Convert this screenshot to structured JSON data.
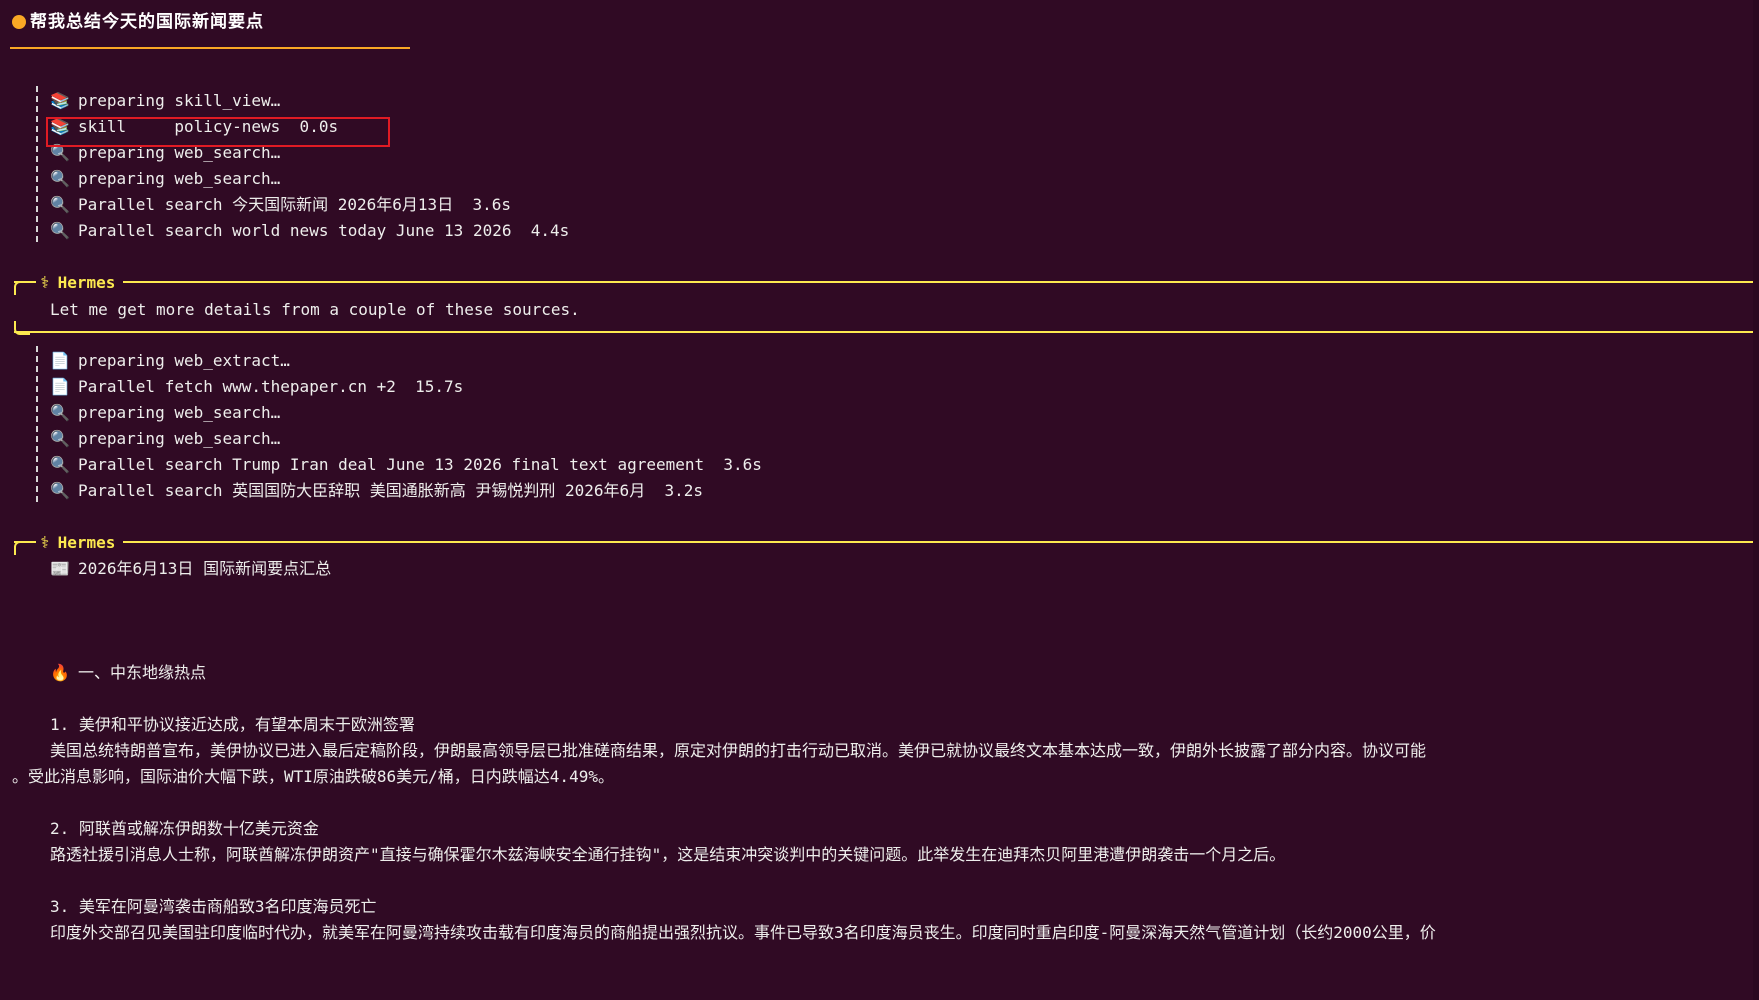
{
  "title": {
    "text": "帮我总结今天的国际新闻要点",
    "dot_color": "#f9a825"
  },
  "tools_1": [
    {
      "icon": "📚",
      "icon_name": "books-icon",
      "text": "preparing skill_view…"
    },
    {
      "icon": "📚",
      "icon_name": "books-icon",
      "text": "skill     policy-news  0.0s"
    },
    {
      "icon": "🔍",
      "icon_name": "search-icon",
      "text": "preparing web_search…"
    },
    {
      "icon": "🔍",
      "icon_name": "search-icon",
      "text": "preparing web_search…"
    },
    {
      "icon": "🔍",
      "icon_name": "search-icon",
      "text": "Parallel search 今天国际新闻 2026年6月13日  3.6s"
    },
    {
      "icon": "🔍",
      "icon_name": "search-icon",
      "text": "Parallel search world news today June 13 2026  4.4s"
    }
  ],
  "hermes_1": {
    "label": "Hermes",
    "symbol": "⚕",
    "text": "Let me get more details from a couple of these sources."
  },
  "tools_2": [
    {
      "icon": "📄",
      "icon_name": "document-icon",
      "text": "preparing web_extract…"
    },
    {
      "icon": "📄",
      "icon_name": "document-icon",
      "text": "Parallel fetch www.thepaper.cn +2  15.7s"
    },
    {
      "icon": "🔍",
      "icon_name": "search-icon",
      "text": "preparing web_search…"
    },
    {
      "icon": "🔍",
      "icon_name": "search-icon",
      "text": "preparing web_search…"
    },
    {
      "icon": "🔍",
      "icon_name": "search-icon",
      "text": "Parallel search Trump Iran deal June 13 2026 final text agreement  3.6s"
    },
    {
      "icon": "🔍",
      "icon_name": "search-icon",
      "text": "Parallel search 英国国防大臣辞职 美国通胀新高 尹锡悦判刑 2026年6月  3.2s"
    }
  ],
  "hermes_2": {
    "label": "Hermes",
    "symbol": "⚕",
    "heading_icon": "📰",
    "heading": "2026年6月13日 国际新闻要点汇总",
    "section_icon": "🔥",
    "section": "一、中东地缘热点",
    "items": [
      {
        "title": "1. 美伊和平协议接近达成，有望本周末于欧洲签署",
        "body": "美国总统特朗普宣布，美伊协议已进入最后定稿阶段，伊朗最高领导层已批准磋商结果，原定对伊朗的打击行动已取消。美伊已就协议最终文本基本达成一致，伊朗外长披露了部分内容。协议可能",
        "body_cont": "。受此消息影响，国际油价大幅下跌，WTI原油跌破86美元/桶，日内跌幅达4.49%。"
      },
      {
        "title": "2. 阿联酋或解冻伊朗数十亿美元资金",
        "body": "路透社援引消息人士称，阿联酋解冻伊朗资产\"直接与确保霍尔木兹海峡安全通行挂钩\"，这是结束冲突谈判中的关键问题。此举发生在迪拜杰贝阿里港遭伊朗袭击一个月之后。"
      },
      {
        "title": "3. 美军在阿曼湾袭击商船致3名印度海员死亡",
        "body": "印度外交部召见美国驻印度临时代办，就美军在阿曼湾持续攻击载有印度海员的商船提出强烈抗议。事件已导致3名印度海员丧生。印度同时重启印度-阿曼深海天然气管道计划（长约2000公里，价"
      }
    ]
  },
  "colors": {
    "background": "#300a24",
    "accent_yellow": "#fce94f",
    "highlight_red": "#e01b24",
    "text": "#eeeeec"
  }
}
